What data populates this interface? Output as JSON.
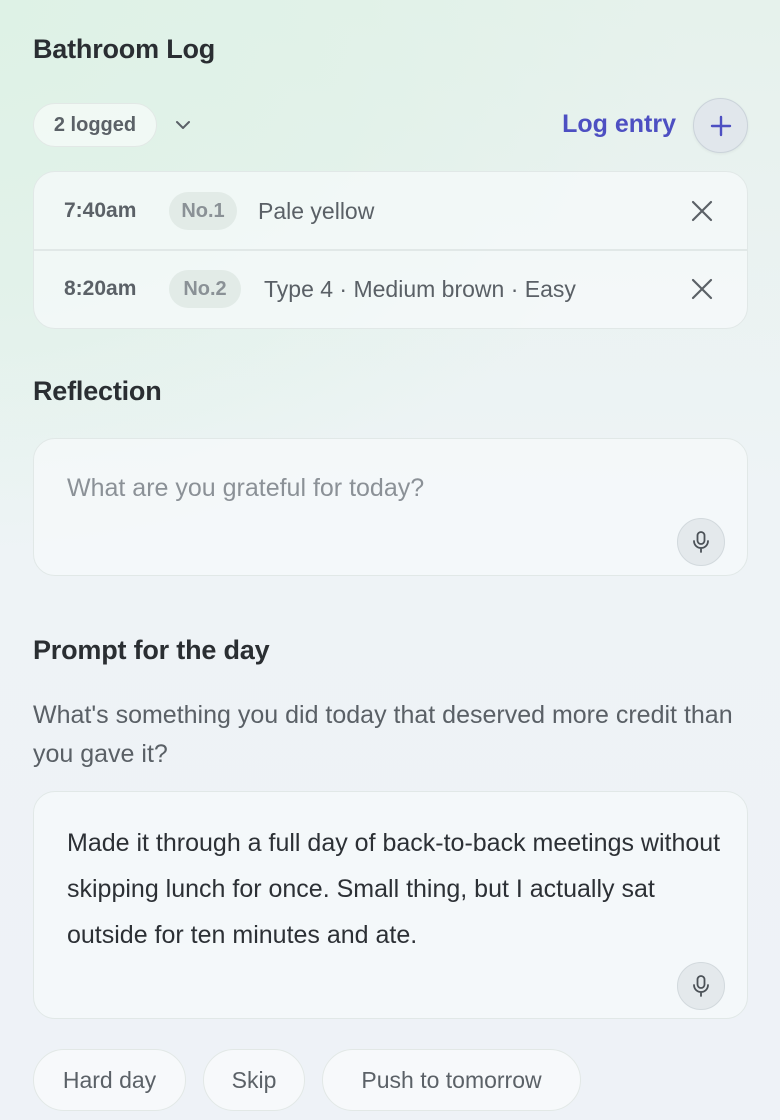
{
  "bathroom": {
    "title": "Bathroom Log",
    "count_label": "2 logged",
    "log_entry_label": "Log entry",
    "entries": [
      {
        "time": "7:40am",
        "tag": "No.1",
        "description": "Pale yellow"
      },
      {
        "time": "8:20am",
        "tag": "No.2",
        "description": "Type 4 · Medium brown · Easy"
      }
    ]
  },
  "reflection": {
    "title": "Reflection",
    "placeholder": "What are you grateful for today?",
    "value": ""
  },
  "prompt": {
    "title": "Prompt for the day",
    "question": "What's something you did today that deserved more credit than you gave it?",
    "answer": "Made it through a full day of back-to-back meetings without skipping lunch for once. Small thing, but I actually sat outside for ten minutes and ate."
  },
  "actions": {
    "hard_day": "Hard day",
    "skip": "Skip",
    "push": "Push to tomorrow"
  },
  "colors": {
    "accent": "#4d4fc2",
    "text": "#2a2e32",
    "muted": "#5b6167"
  },
  "icons": {
    "expand": "chevron-down-icon",
    "add": "plus-icon",
    "remove": "close-icon",
    "voice": "microphone-icon"
  }
}
